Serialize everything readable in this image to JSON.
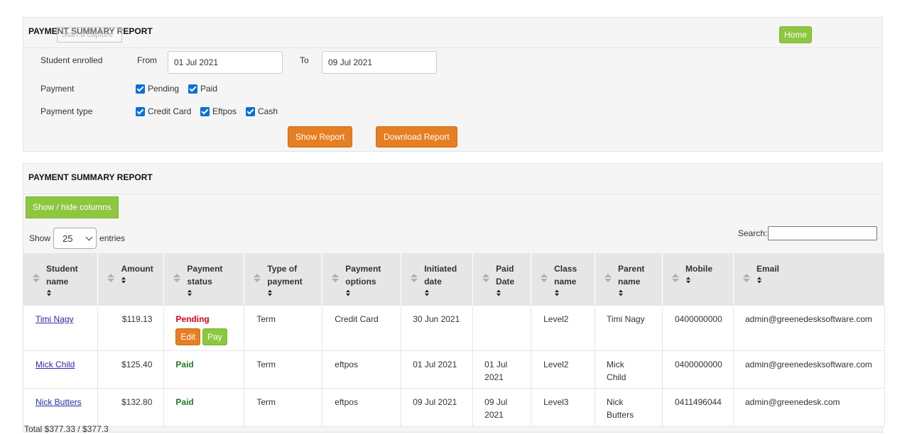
{
  "filter_panel": {
    "title": "PAYMENT SUMMARY REPORT",
    "overlay_text": "Start a capture",
    "home_button": "Home",
    "student_enrolled_label": "Student enrolled",
    "from_label": "From",
    "from_value": "01 Jul 2021",
    "to_label": "To",
    "to_value": "09 Jul 2021",
    "payment_label": "Payment",
    "payment_options": [
      {
        "label": "Pending",
        "checked": true
      },
      {
        "label": "Paid",
        "checked": true
      }
    ],
    "payment_type_label": "Payment type",
    "payment_type_options": [
      {
        "label": "Credit Card",
        "checked": true
      },
      {
        "label": "Eftpos",
        "checked": true
      },
      {
        "label": "Cash",
        "checked": true
      }
    ],
    "show_report_button": "Show Report",
    "download_report_button": "Download Report"
  },
  "report_panel": {
    "title": "PAYMENT SUMMARY REPORT",
    "show_hide_button": "Show / hide columns",
    "show_label": "Show",
    "entries_value": "25",
    "entries_label": "entries",
    "search_label": "Search:",
    "search_value": "",
    "columns": [
      [
        "Student",
        "name"
      ],
      [
        "Amount",
        ""
      ],
      [
        "Payment",
        "status"
      ],
      [
        "Type of",
        "payment"
      ],
      [
        "Payment",
        "options"
      ],
      [
        "Initiated",
        "date"
      ],
      [
        "Paid",
        "Date"
      ],
      [
        "Class",
        "name"
      ],
      [
        "Parent",
        "name"
      ],
      [
        "Mobile",
        ""
      ],
      [
        "Email",
        ""
      ]
    ],
    "rows": [
      {
        "student": "Timi Nagy",
        "amount": "$119.13",
        "status": "Pending",
        "type": "Term",
        "option": "Credit Card",
        "initiated": "30 Jun 2021",
        "paid_date": "",
        "class": "Level2",
        "parent": "Timi Nagy",
        "mobile": "0400000000",
        "email": "admin@greenedesksoftware.com",
        "edit_button": "Edit",
        "pay_button": "Pay"
      },
      {
        "student": "Mick Child",
        "amount": "$125.40",
        "status": "Paid",
        "type": "Term",
        "option": "eftpos",
        "initiated": "01 Jul 2021",
        "paid_date": "01 Jul 2021",
        "class": "Level2",
        "parent": "Mick Child",
        "mobile": "0400000000",
        "email": "admin@greenedesksoftware.com"
      },
      {
        "student": "Nick Butters",
        "amount": "$132.80",
        "status": "Paid",
        "type": "Term",
        "option": "eftpos",
        "initiated": "09 Jul 2021",
        "paid_date": "09 Jul 2021",
        "class": "Level3",
        "parent": "Nick Butters",
        "mobile": "0411496044",
        "email": "admin@greenedesk.com"
      }
    ],
    "footer_text": "Total                    $377.33 / $377.3"
  },
  "colors": {
    "orange": "#e67e22",
    "green": "#8dc63f",
    "pending": "#e0001b",
    "paid": "#1e7b1e"
  }
}
